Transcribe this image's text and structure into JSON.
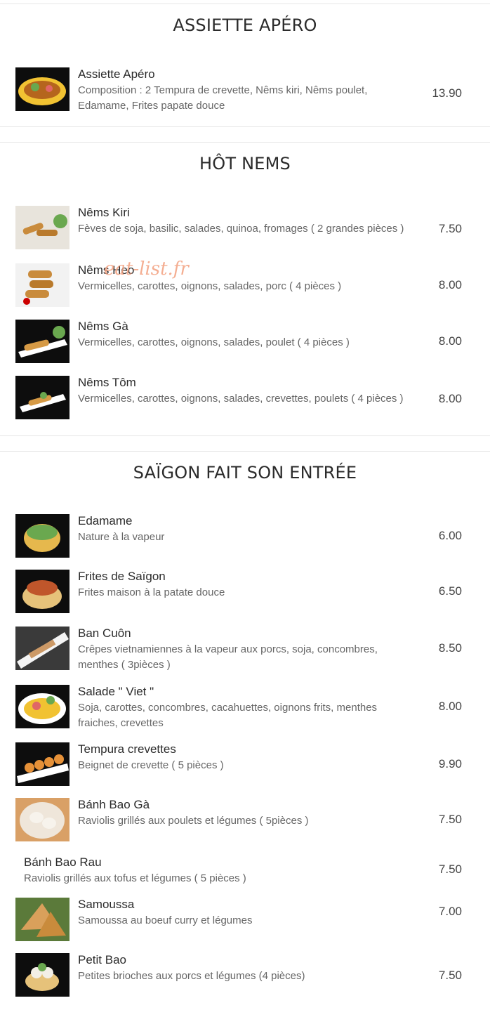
{
  "watermark": "eat-list.fr",
  "sections": [
    {
      "title": "ASSIETTE APÉRO",
      "items": [
        {
          "name": "Assiette Apéro",
          "desc": "Composition : 2 Tempura de crevette, Nêms kiri, Nêms poulet, Edamame, Frites papate douce",
          "price": "13.90",
          "image": "plate-icon"
        }
      ]
    },
    {
      "title": "HÔT NEMS",
      "items": [
        {
          "name": "Nêms Kiri",
          "desc": "Fèves de soja, basilic, salades, quinoa, fromages ( 2 grandes pièces )",
          "price": "7.50",
          "image": "nems-icon"
        },
        {
          "name": "Nêms Heo",
          "desc": "Vermicelles, carottes, oignons, salades, porc ( 4 pièces )",
          "price": "8.00",
          "image": "nems-icon"
        },
        {
          "name": "Nêms Gà",
          "desc": "Vermicelles, carottes, oignons, salades, poulet ( 4 pièces )",
          "price": "8.00",
          "image": "nems-icon"
        },
        {
          "name": "Nêms Tôm",
          "desc": "Vermicelles, carottes, oignons, salades, crevettes, poulets ( 4 pièces )",
          "price": "8.00",
          "image": "nems-icon"
        }
      ]
    },
    {
      "title": "SAÏGON FAIT SON ENTRÉE",
      "items": [
        {
          "name": "Edamame",
          "desc": "Nature à la vapeur",
          "price": "6.00",
          "image": "bowl-icon"
        },
        {
          "name": "Frites de Saïgon",
          "desc": "Frites maison à la patate douce",
          "price": "6.50",
          "image": "bowl-icon"
        },
        {
          "name": "Ban Cuôn",
          "desc": "Crêpes vietnamiennes à la vapeur aux porcs, soja, concombres, menthes ( 3pièces )",
          "price": "8.50",
          "image": "plate-icon"
        },
        {
          "name": "Salade \" Viet \"",
          "desc": "Soja, carottes, concombres, cacahuettes, oignons frits, menthes fraiches, crevettes",
          "price": "8.00",
          "image": "plate-icon"
        },
        {
          "name": "Tempura crevettes",
          "desc": "Beignet de crevette ( 5 pièces )",
          "price": "9.90",
          "image": "plate-icon"
        },
        {
          "name": "Bánh Bao Gà",
          "desc": "Raviolis grillés aux poulets et légumes ( 5pièces )",
          "price": "7.50",
          "image": "bowl-icon"
        },
        {
          "name": "Bánh Bao Rau",
          "desc": "Raviolis grillés aux tofus et légumes ( 5 pièces )",
          "price": "7.50",
          "image": ""
        },
        {
          "name": "Samoussa",
          "desc": "Samoussa au boeuf curry et légumes",
          "price": "7.00",
          "image": "samosa-icon"
        },
        {
          "name": "Petit Bao",
          "desc": "Petites brioches aux porcs et légumes (4 pièces)",
          "price": "7.50",
          "image": "bowl-icon"
        }
      ]
    }
  ]
}
